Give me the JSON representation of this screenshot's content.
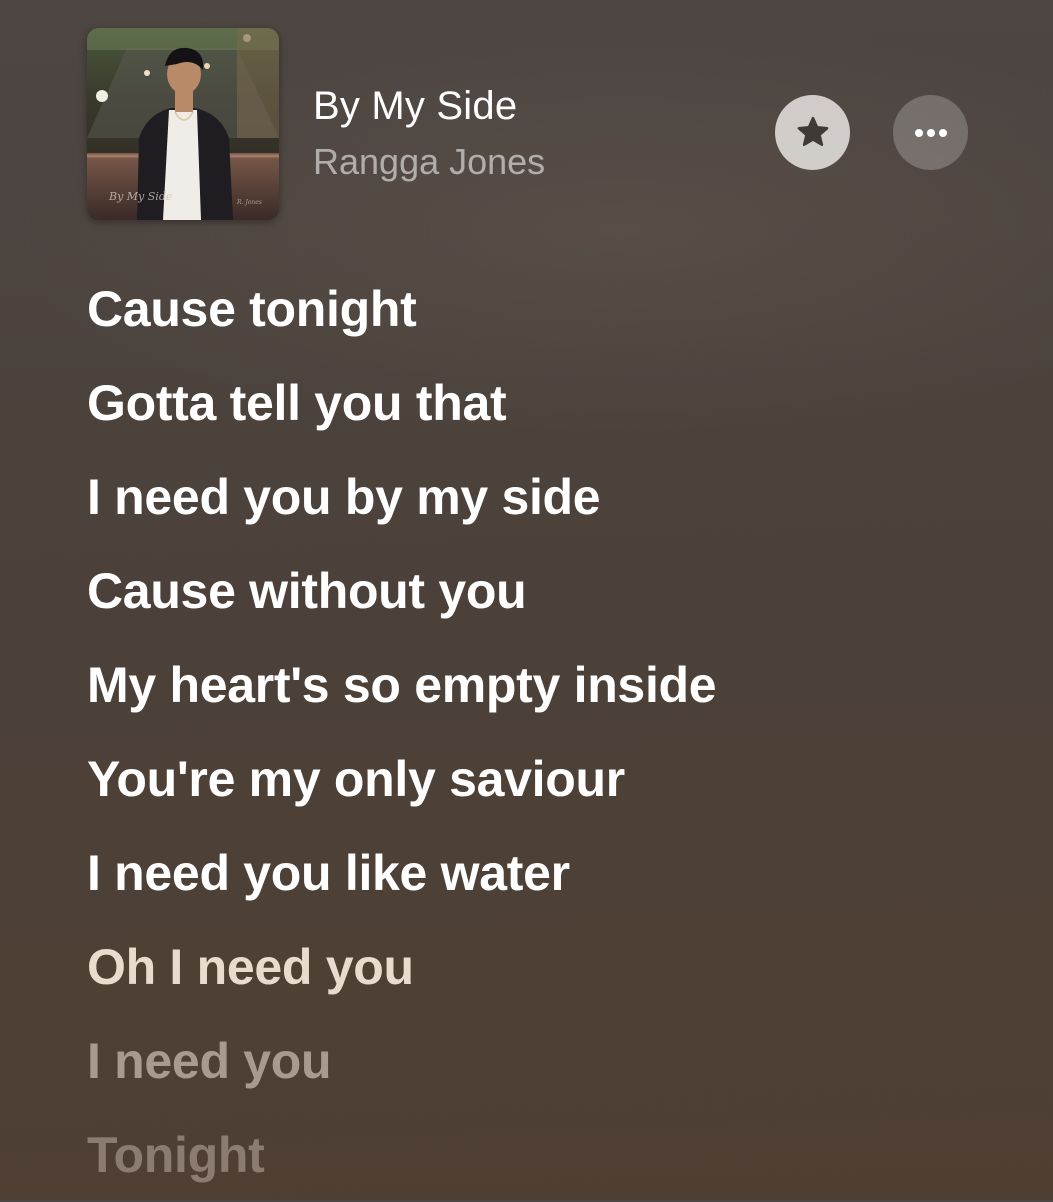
{
  "now_playing": {
    "title": "By My Side",
    "artist": "Rangga Jones",
    "artwork_icon": "album-artwork"
  },
  "controls": {
    "favorite_icon": "star-icon",
    "more_icon": "ellipsis-icon"
  },
  "lyrics": [
    {
      "text": "Cause tonight",
      "state": "active"
    },
    {
      "text": "Gotta tell you that",
      "state": "active"
    },
    {
      "text": "I need you by my side",
      "state": "active"
    },
    {
      "text": "Cause without you",
      "state": "active"
    },
    {
      "text": "My heart's so empty inside",
      "state": "active"
    },
    {
      "text": "You're my only saviour",
      "state": "active"
    },
    {
      "text": "I need you like water",
      "state": "active"
    },
    {
      "text": "Oh I need you",
      "state": "upcoming-1"
    },
    {
      "text": "I need you",
      "state": "upcoming-2"
    },
    {
      "text": "Tonight",
      "state": "upcoming-3"
    }
  ],
  "colors": {
    "background_top": "#4d4643",
    "background_bottom": "#4f3f33",
    "favorite_button": "#e8e4e0",
    "text_primary": "#ffffff"
  }
}
